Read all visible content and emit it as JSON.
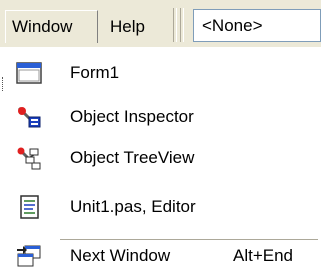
{
  "menubar": {
    "window_label": "Window",
    "help_label": "Help",
    "combo_value": "<None>"
  },
  "window_menu": {
    "items": [
      {
        "label": "Form1",
        "icon": "form-window-icon",
        "shortcut": ""
      },
      {
        "label": "Object Inspector",
        "icon": "object-inspector-icon",
        "shortcut": ""
      },
      {
        "label": "Object TreeView",
        "icon": "object-treeview-icon",
        "shortcut": ""
      },
      {
        "label": "Unit1.pas, Editor",
        "icon": "unit-editor-icon",
        "shortcut": ""
      },
      {
        "label": "Next Window",
        "icon": "next-window-icon",
        "shortcut": "Alt+End"
      }
    ]
  },
  "colors": {
    "menubar_bg": "#ece9d8",
    "combo_border": "#7f9db9",
    "window_titlebar_blue": "#2a5fd6"
  }
}
